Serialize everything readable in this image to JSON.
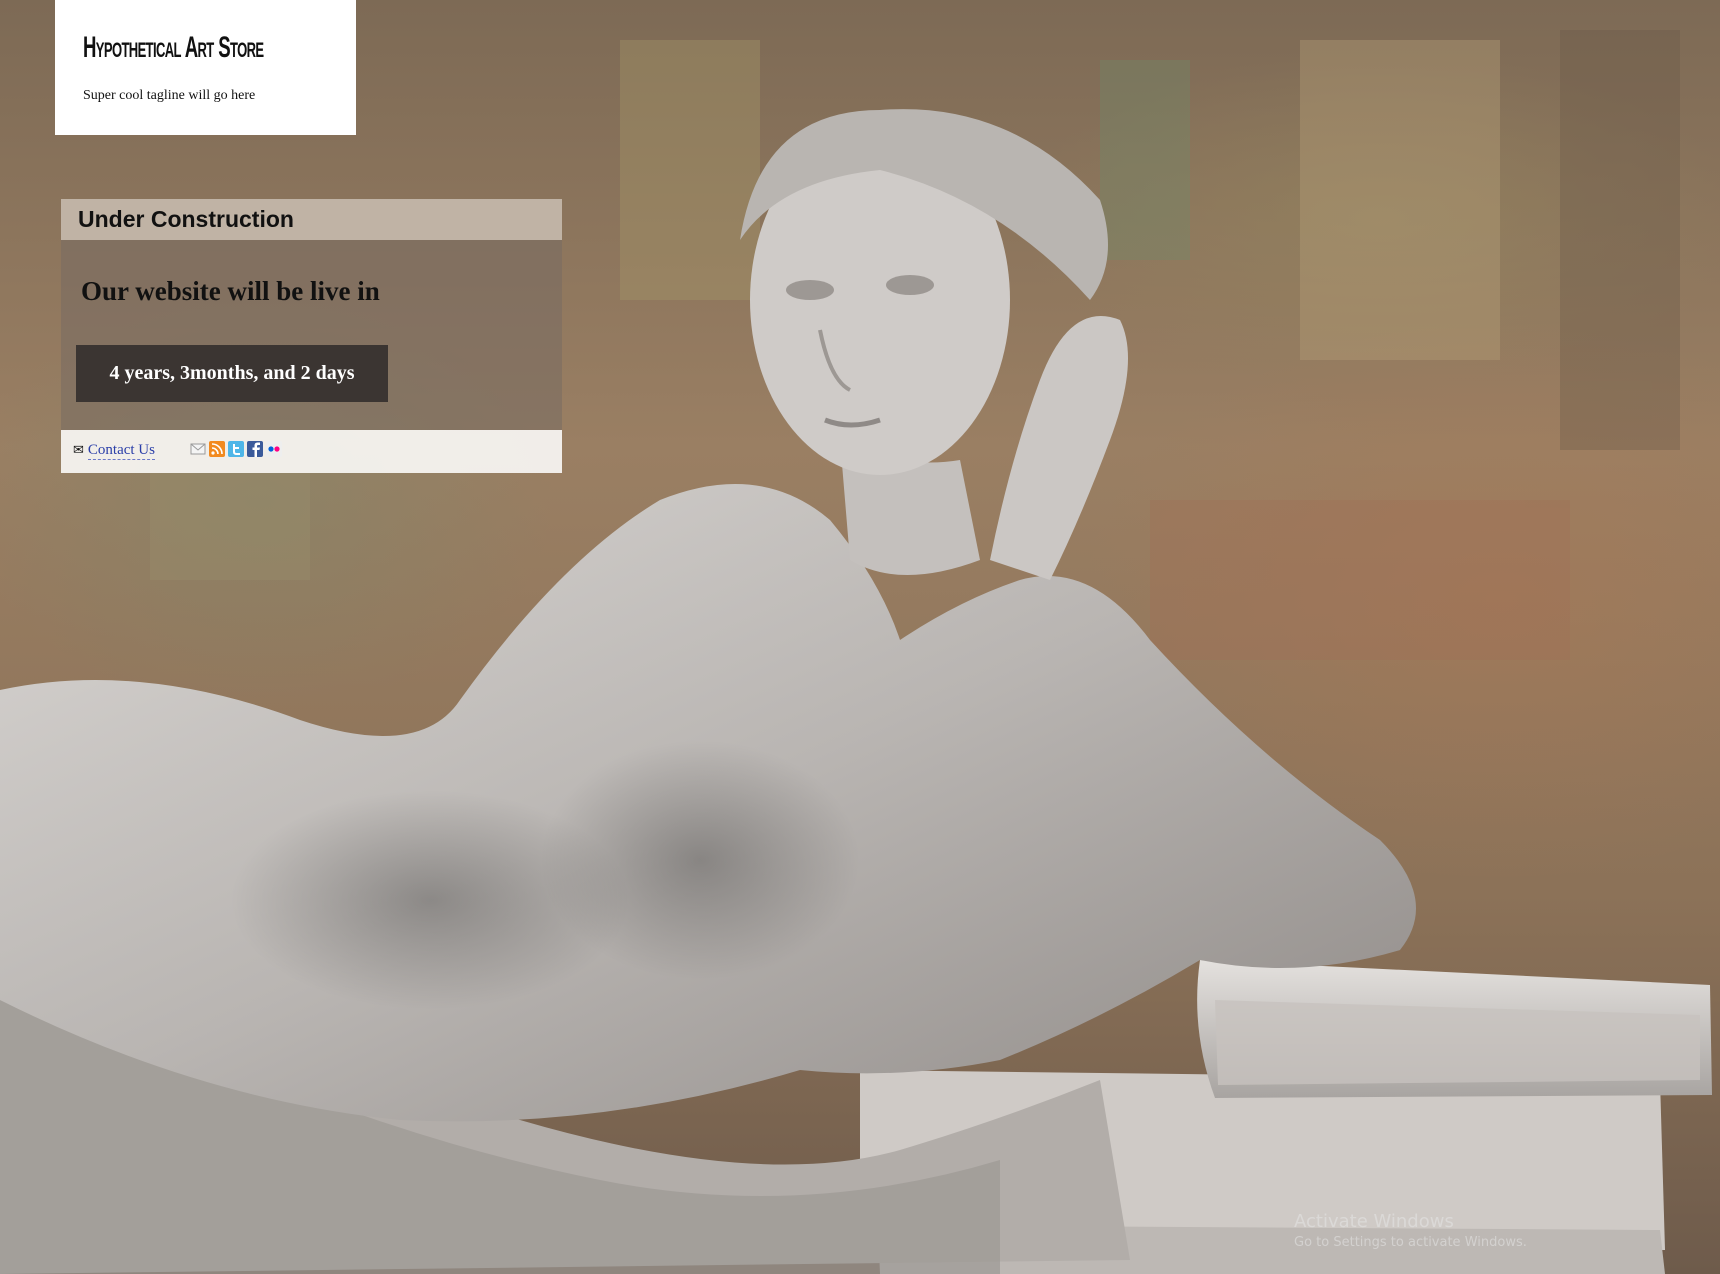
{
  "site": {
    "title": "Hypothetical Art Store",
    "tagline": "Super cool tagline will go here"
  },
  "notice": {
    "title": "Under Construction",
    "headline": "Our website will be live in",
    "countdown": "4 years, 3months, and 2 days"
  },
  "footer": {
    "contact_label": "Contact Us",
    "social_icons": [
      "email-icon",
      "rss-icon",
      "twitter-icon",
      "facebook-icon",
      "flickr-icon"
    ]
  },
  "os_watermark": {
    "title": "Activate Windows",
    "subtitle": "Go to Settings to activate Windows."
  },
  "colors": {
    "countdown_bg": "#3b3532",
    "link": "#2a3ea8",
    "brand_bg": "#ffffff"
  }
}
